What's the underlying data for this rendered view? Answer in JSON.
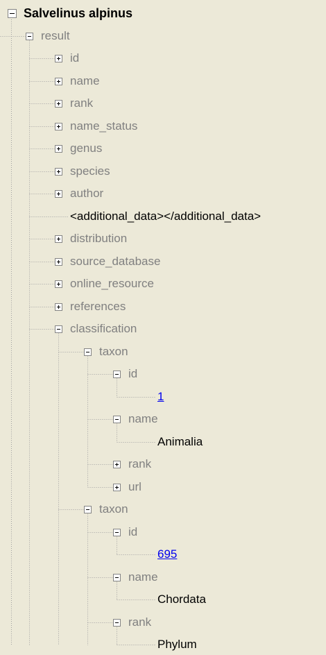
{
  "tree": {
    "root": "Salvelinus alpinus",
    "nodes": [
      {
        "label": "result",
        "depth": 1,
        "state": "expanded",
        "kind": "node"
      },
      {
        "label": "id",
        "depth": 2,
        "state": "collapsed",
        "kind": "node"
      },
      {
        "label": "name",
        "depth": 2,
        "state": "collapsed",
        "kind": "node"
      },
      {
        "label": "rank",
        "depth": 2,
        "state": "collapsed",
        "kind": "node"
      },
      {
        "label": "name_status",
        "depth": 2,
        "state": "collapsed",
        "kind": "node"
      },
      {
        "label": "genus",
        "depth": 2,
        "state": "collapsed",
        "kind": "node"
      },
      {
        "label": "species",
        "depth": 2,
        "state": "collapsed",
        "kind": "node"
      },
      {
        "label": "author",
        "depth": 2,
        "state": "collapsed",
        "kind": "node"
      },
      {
        "label": "<additional_data></additional_data>",
        "depth": 2,
        "state": "leaf",
        "kind": "value"
      },
      {
        "label": "distribution",
        "depth": 2,
        "state": "collapsed",
        "kind": "node"
      },
      {
        "label": "source_database",
        "depth": 2,
        "state": "collapsed",
        "kind": "node"
      },
      {
        "label": "online_resource",
        "depth": 2,
        "state": "collapsed",
        "kind": "node"
      },
      {
        "label": "references",
        "depth": 2,
        "state": "collapsed",
        "kind": "node"
      },
      {
        "label": "classification",
        "depth": 2,
        "state": "expanded",
        "kind": "node"
      },
      {
        "label": "taxon",
        "depth": 3,
        "state": "expanded",
        "kind": "node"
      },
      {
        "label": "id",
        "depth": 4,
        "state": "expanded",
        "kind": "node"
      },
      {
        "label": "1",
        "depth": 5,
        "state": "leaf",
        "kind": "link"
      },
      {
        "label": "name",
        "depth": 4,
        "state": "expanded",
        "kind": "node"
      },
      {
        "label": "Animalia",
        "depth": 5,
        "state": "leaf",
        "kind": "value"
      },
      {
        "label": "rank",
        "depth": 4,
        "state": "collapsed",
        "kind": "node"
      },
      {
        "label": "url",
        "depth": 4,
        "state": "collapsed",
        "kind": "node"
      },
      {
        "label": "taxon",
        "depth": 3,
        "state": "expanded",
        "kind": "node"
      },
      {
        "label": "id",
        "depth": 4,
        "state": "expanded",
        "kind": "node"
      },
      {
        "label": "695",
        "depth": 5,
        "state": "leaf",
        "kind": "link"
      },
      {
        "label": "name",
        "depth": 4,
        "state": "expanded",
        "kind": "node"
      },
      {
        "label": "Chordata",
        "depth": 5,
        "state": "leaf",
        "kind": "value"
      },
      {
        "label": "rank",
        "depth": 4,
        "state": "expanded",
        "kind": "node"
      },
      {
        "label": "Phylum",
        "depth": 5,
        "state": "leaf",
        "kind": "value"
      }
    ]
  },
  "colors": {
    "background": "#ece9d8",
    "node_label": "#808080",
    "value_label": "#000000",
    "link": "#0000ee",
    "connector": "#a0a0a0",
    "box_border": "#848484"
  }
}
